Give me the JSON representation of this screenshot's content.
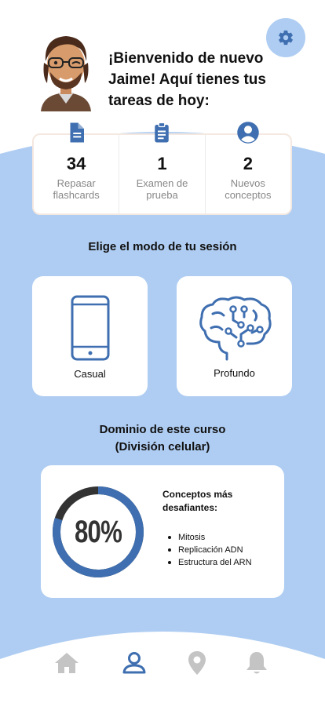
{
  "colors": {
    "accent": "#3f6fb0",
    "background_blue": "#afcdf2",
    "ring_track": "#333333",
    "inactive_nav": "#c4c4c4"
  },
  "header": {
    "settings_icon": "gear-icon",
    "welcome_text": "¡Bienvenido de nuevo Jaime! Aquí tienes tus tareas de hoy:"
  },
  "stats": [
    {
      "icon": "document-icon",
      "value": "34",
      "label_line1": "Repasar",
      "label_line2": "flashcards"
    },
    {
      "icon": "clipboard-icon",
      "value": "1",
      "label_line1": "Examen de",
      "label_line2": "prueba"
    },
    {
      "icon": "person-circle-icon",
      "value": "2",
      "label_line1": "Nuevos",
      "label_line2": "conceptos"
    }
  ],
  "mode_section": {
    "title": "Elige el modo de tu sesión",
    "modes": [
      {
        "icon": "phone-icon",
        "label": "Casual"
      },
      {
        "icon": "brain-circuit-icon",
        "label": "Profundo"
      }
    ]
  },
  "mastery": {
    "title_line1": "Dominio de este curso",
    "title_line2": "(División celular)",
    "percent_text": "80%",
    "progress": 0.8,
    "challenging_title": "Conceptos más desafiantes:",
    "challenging": [
      "Mitosis",
      "Replicación ADN",
      "Estructura del ARN"
    ]
  },
  "nav": [
    {
      "icon": "home-icon",
      "active": false
    },
    {
      "icon": "person-icon",
      "active": true
    },
    {
      "icon": "map-pin-icon",
      "active": false
    },
    {
      "icon": "bell-icon",
      "active": false
    }
  ]
}
